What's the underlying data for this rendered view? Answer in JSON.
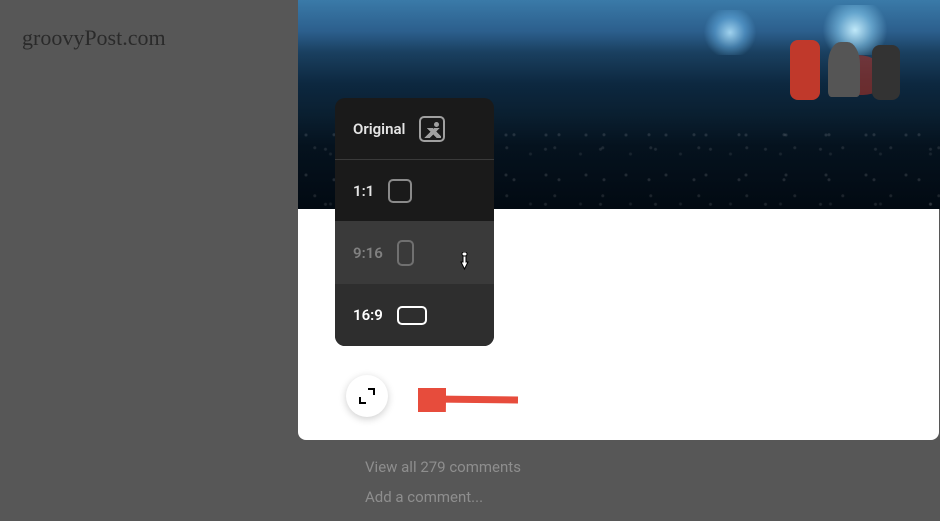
{
  "watermark": "groovyPost.com",
  "aspect_menu": {
    "items": [
      {
        "label": "Original",
        "icon": "original",
        "state": "default"
      },
      {
        "label": "1:1",
        "icon": "1-1",
        "state": "default"
      },
      {
        "label": "9:16",
        "icon": "9-16",
        "state": "hover"
      },
      {
        "label": "16:9",
        "icon": "16-9",
        "state": "selected"
      }
    ]
  },
  "comments": {
    "view_all": "View all 279 comments",
    "add_placeholder": "Add a comment..."
  }
}
